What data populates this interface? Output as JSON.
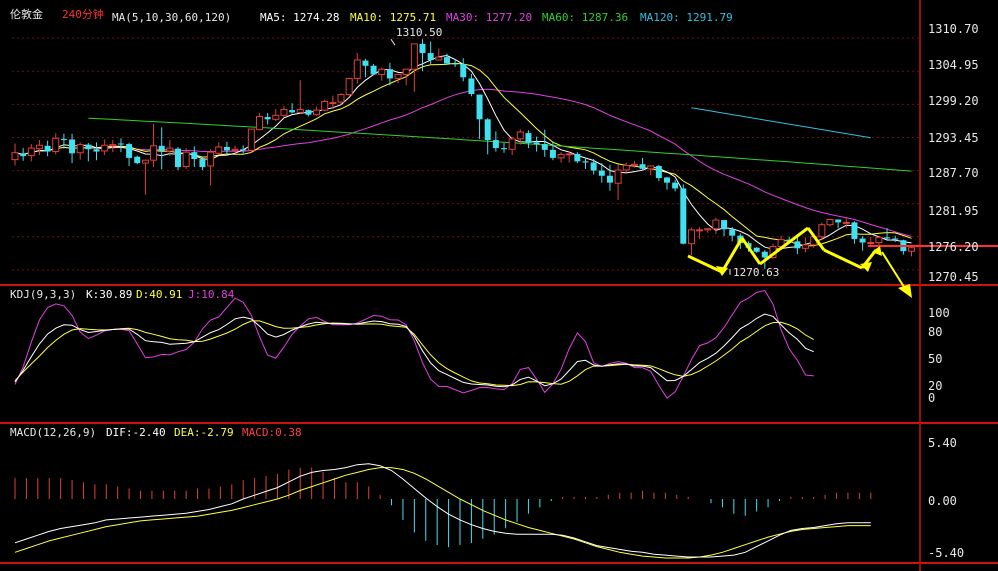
{
  "header": {
    "symbol": "伦敦金",
    "period": "240分钟",
    "ma_spec": "MA(5,10,30,60,120)",
    "ma5": "MA5: 1274.28",
    "ma10": "MA10: 1275.71",
    "ma30": "MA30: 1277.20",
    "ma60": "MA60: 1287.36",
    "ma120": "MA120: 1291.79"
  },
  "colors": {
    "background": "#000000",
    "up": "#e0403a",
    "down": "#40e0f0",
    "ma5": "#ffffff",
    "ma10": "#ffff40",
    "ma30": "#e040e0",
    "ma60": "#30d030",
    "ma120": "#30c0e0",
    "separator": "#d01010",
    "arrow": "#ffff00",
    "hline": "#ff3030",
    "grid": "#6a1010"
  },
  "price_panel": {
    "ticks": [
      "1310.70",
      "1304.95",
      "1299.20",
      "1293.45",
      "1287.70",
      "1281.95",
      "1276.20",
      "1270.45"
    ],
    "high_label": "1310.50",
    "low_label": "1270.63"
  },
  "kdj_panel": {
    "header": "KDJ(9,3,3)",
    "k": "K:30.89",
    "d": "D:40.91",
    "j": "J:10.84",
    "ticks": [
      "100",
      "80",
      "50",
      "20",
      "0"
    ]
  },
  "macd_panel": {
    "header": "MACD(12,26,9)",
    "dif": "DIF:-2.40",
    "dea": "DEA:-2.79",
    "macd": "MACD:0.38",
    "ticks": [
      "5.40",
      "0.00",
      "-5.40"
    ]
  },
  "chart_data": {
    "type": "candlestick",
    "title": "伦敦金 240分钟",
    "price_range": [
      1268.0,
      1313.5
    ],
    "candles": [
      [
        1289.6,
        1290.8,
        1288.6,
        1292.4
      ],
      [
        1290.7,
        1290.2,
        1289.4,
        1291.6
      ],
      [
        1290.3,
        1291.6,
        1289.3,
        1292.3
      ],
      [
        1291.5,
        1292.1,
        1290.4,
        1293.0
      ],
      [
        1292.0,
        1291.0,
        1290.2,
        1292.9
      ],
      [
        1291.0,
        1293.3,
        1290.5,
        1294.2
      ],
      [
        1293.2,
        1293.0,
        1291.5,
        1294.1
      ],
      [
        1293.1,
        1290.7,
        1289.0,
        1294.1
      ],
      [
        1290.8,
        1292.2,
        1289.6,
        1292.6
      ],
      [
        1292.2,
        1291.4,
        1289.3,
        1292.5
      ],
      [
        1291.4,
        1291.0,
        1289.5,
        1292.6
      ],
      [
        1291.1,
        1292.1,
        1290.4,
        1293.1
      ],
      [
        1292.0,
        1292.2,
        1290.9,
        1293.0
      ],
      [
        1292.4,
        1292.3,
        1290.9,
        1293.3
      ],
      [
        1292.3,
        1289.9,
        1288.5,
        1292.5
      ],
      [
        1290.1,
        1289.0,
        1288.8,
        1290.3
      ],
      [
        1289.0,
        1289.5,
        1283.5,
        1289.6
      ],
      [
        1289.5,
        1292.0,
        1288.3,
        1295.8
      ],
      [
        1292.0,
        1291.1,
        1287.9,
        1295.2
      ],
      [
        1291.1,
        1291.6,
        1290.2,
        1293.0
      ],
      [
        1291.5,
        1288.3,
        1287.8,
        1291.8
      ],
      [
        1288.4,
        1290.9,
        1288.0,
        1291.6
      ],
      [
        1290.9,
        1289.7,
        1288.3,
        1291.9
      ],
      [
        1289.7,
        1288.3,
        1287.8,
        1290.0
      ],
      [
        1288.5,
        1290.9,
        1285.1,
        1291.4
      ],
      [
        1290.7,
        1291.8,
        1290.4,
        1292.6
      ],
      [
        1291.8,
        1291.2,
        1290.4,
        1292.7
      ],
      [
        1291.2,
        1291.4,
        1290.7,
        1292.0
      ],
      [
        1291.4,
        1291.2,
        1290.6,
        1292.1
      ],
      [
        1291.2,
        1294.9,
        1290.8,
        1294.9
      ],
      [
        1294.8,
        1297.1,
        1294.7,
        1297.7
      ],
      [
        1297.0,
        1296.6,
        1295.7,
        1297.7
      ],
      [
        1296.6,
        1297.3,
        1296.3,
        1298.4
      ],
      [
        1297.3,
        1298.3,
        1297.0,
        1298.9
      ],
      [
        1298.2,
        1297.8,
        1297.6,
        1299.4
      ],
      [
        1297.8,
        1298.3,
        1297.6,
        1303.4
      ],
      [
        1298.2,
        1297.4,
        1297.1,
        1298.3
      ],
      [
        1297.4,
        1298.2,
        1297.2,
        1298.8
      ],
      [
        1298.2,
        1299.7,
        1298.0,
        1300.0
      ],
      [
        1299.5,
        1299.5,
        1298.4,
        1300.7
      ],
      [
        1299.6,
        1300.9,
        1299.2,
        1301.1
      ],
      [
        1300.9,
        1303.7,
        1300.7,
        1303.8
      ],
      [
        1303.7,
        1306.9,
        1302.8,
        1308.1
      ],
      [
        1306.8,
        1305.9,
        1303.9,
        1307.1
      ],
      [
        1305.9,
        1304.4,
        1304.3,
        1306.2
      ],
      [
        1304.4,
        1305.3,
        1303.3,
        1305.6
      ],
      [
        1305.3,
        1303.7,
        1302.5,
        1306.4
      ],
      [
        1303.7,
        1304.4,
        1302.9,
        1304.5
      ],
      [
        1304.4,
        1305.3,
        1302.5,
        1305.4
      ],
      [
        1305.3,
        1309.7,
        1301.4,
        1309.7
      ],
      [
        1309.7,
        1308.1,
        1305.0,
        1310.5
      ],
      [
        1308.1,
        1306.9,
        1306.2,
        1310.1
      ],
      [
        1306.9,
        1307.4,
        1306.8,
        1308.9
      ],
      [
        1307.4,
        1306.3,
        1306.1,
        1308.0
      ],
      [
        1306.3,
        1306.2,
        1305.7,
        1307.0
      ],
      [
        1306.2,
        1303.9,
        1303.2,
        1307.2
      ],
      [
        1303.7,
        1301.0,
        1300.6,
        1304.5
      ],
      [
        1300.9,
        1296.6,
        1293.2,
        1300.9
      ],
      [
        1296.6,
        1293.0,
        1290.5,
        1296.8
      ],
      [
        1293.0,
        1291.6,
        1291.0,
        1294.5
      ],
      [
        1291.6,
        1291.4,
        1290.8,
        1292.5
      ],
      [
        1291.4,
        1293.2,
        1290.4,
        1293.5
      ],
      [
        1293.2,
        1294.4,
        1292.2,
        1294.9
      ],
      [
        1294.2,
        1292.5,
        1291.6,
        1294.7
      ],
      [
        1292.6,
        1292.3,
        1291.0,
        1293.6
      ],
      [
        1292.3,
        1291.3,
        1290.1,
        1294.8
      ],
      [
        1291.3,
        1289.9,
        1289.5,
        1292.7
      ],
      [
        1289.9,
        1290.5,
        1289.1,
        1290.9
      ],
      [
        1290.5,
        1290.6,
        1289.1,
        1291.0
      ],
      [
        1290.6,
        1289.3,
        1289.0,
        1290.9
      ],
      [
        1289.3,
        1289.1,
        1288.0,
        1290.0
      ],
      [
        1289.1,
        1287.7,
        1287.0,
        1289.7
      ],
      [
        1287.7,
        1286.8,
        1285.6,
        1289.0
      ],
      [
        1286.8,
        1285.6,
        1284.2,
        1288.7
      ],
      [
        1285.5,
        1287.8,
        1282.6,
        1288.8
      ],
      [
        1287.8,
        1288.6,
        1287.4,
        1289.1
      ],
      [
        1288.6,
        1288.8,
        1288.2,
        1289.4
      ],
      [
        1288.8,
        1288.0,
        1287.7,
        1289.9
      ],
      [
        1288.0,
        1288.5,
        1286.9,
        1288.6
      ],
      [
        1288.5,
        1286.4,
        1285.9,
        1288.7
      ],
      [
        1286.5,
        1285.6,
        1284.4,
        1286.6
      ],
      [
        1285.6,
        1284.6,
        1284.1,
        1286.1
      ],
      [
        1284.6,
        1275.0,
        1274.9,
        1285.3
      ],
      [
        1275.0,
        1277.4,
        1273.0,
        1277.8
      ],
      [
        1277.4,
        1277.4,
        1275.8,
        1277.9
      ],
      [
        1277.4,
        1277.6,
        1276.9,
        1277.7
      ],
      [
        1277.6,
        1279.1,
        1276.7,
        1279.5
      ],
      [
        1279.1,
        1277.5,
        1276.3,
        1279.1
      ],
      [
        1277.5,
        1276.4,
        1275.4,
        1277.9
      ],
      [
        1276.4,
        1275.1,
        1274.1,
        1276.8
      ],
      [
        1275.1,
        1274.3,
        1273.6,
        1275.4
      ],
      [
        1274.3,
        1273.6,
        1273.4,
        1274.4
      ],
      [
        1273.6,
        1272.6,
        1270.6,
        1273.9
      ],
      [
        1272.6,
        1274.5,
        1272.4,
        1275.0
      ],
      [
        1274.5,
        1275.7,
        1274.0,
        1276.4
      ],
      [
        1275.7,
        1275.4,
        1275.2,
        1276.2
      ],
      [
        1275.4,
        1274.2,
        1273.2,
        1276.1
      ],
      [
        1274.2,
        1274.8,
        1273.5,
        1276.1
      ],
      [
        1274.8,
        1276.2,
        1274.3,
        1276.8
      ],
      [
        1276.2,
        1278.3,
        1275.6,
        1278.7
      ],
      [
        1278.3,
        1279.2,
        1278.0,
        1279.3
      ],
      [
        1279.2,
        1278.7,
        1277.7,
        1279.2
      ],
      [
        1278.7,
        1278.7,
        1277.7,
        1279.6
      ],
      [
        1278.7,
        1275.8,
        1275.0,
        1278.9
      ],
      [
        1275.9,
        1275.2,
        1273.8,
        1276.3
      ],
      [
        1275.2,
        1275.2,
        1274.4,
        1276.2
      ],
      [
        1275.2,
        1276.1,
        1274.2,
        1276.4
      ],
      [
        1276.1,
        1275.9,
        1275.5,
        1277.7
      ],
      [
        1275.9,
        1275.7,
        1275.3,
        1276.4
      ],
      [
        1275.6,
        1273.7,
        1273.1,
        1275.7
      ],
      [
        1273.7,
        1274.3,
        1272.8,
        1274.5
      ]
    ],
    "ma60": [
      1296.8,
      1287.6
    ],
    "ma120": [
      1298.6,
      1293.4
    ],
    "kdj": {
      "range": [
        0,
        100
      ],
      "k": [
        22.0,
        31.9,
        43.5,
        54.3,
        62.6,
        67.6,
        70.5,
        70.2,
        66.4,
        64.0,
        64.8,
        65.8,
        66.5,
        67.0,
        66.9,
        62.4,
        57.0,
        56.1,
        55.6,
        54.1,
        54.5,
        54.9,
        56.1,
        60.1,
        63.9,
        66.4,
        70.8,
        75.6,
        77.0,
        75.4,
        69.4,
        62.6,
        60.1,
        62.3,
        66.0,
        68.7,
        71.2,
        72.6,
        72.0,
        71.5,
        71.4,
        71.1,
        71.3,
        72.5,
        73.7,
        73.2,
        71.4,
        70.9,
        69.1,
        60.5,
        48.5,
        38.1,
        31.6,
        28.3,
        25.0,
        21.7,
        20.3,
        19.9,
        19.5,
        18.4,
        18.0,
        19.6,
        24.2,
        26.2,
        22.9,
        18.8,
        20.6,
        24.5,
        31.8,
        39.4,
        40.4,
        36.4,
        35.4,
        36.6,
        37.4,
        37.3,
        35.7,
        35.5,
        34.2,
        28.6,
        23.1,
        23.3,
        26.8,
        32.6,
        38.5,
        42.1,
        46.4,
        52.6,
        59.7,
        67.2,
        71.1,
        75.9,
        79.7,
        77.6,
        70.4,
        63.6,
        58.1,
        50.6,
        47.7
      ],
      "d": [
        23.1,
        30.5,
        37.4,
        44.1,
        51.3,
        57.3,
        62.5,
        66.1,
        67.3,
        66.7,
        66.3,
        66.1,
        66.5,
        67.1,
        67.6,
        66.4,
        64.1,
        62.5,
        60.7,
        58.7,
        57.9,
        57.5,
        56.3,
        56.6,
        58.5,
        61.0,
        63.6,
        66.8,
        70.8,
        73.8,
        73.8,
        71.5,
        69.0,
        67.6,
        67.7,
        68.3,
        69.0,
        70.4,
        71.4,
        72.0,
        71.8,
        71.4,
        70.9,
        71.2,
        71.3,
        70.9,
        69.7,
        69.1,
        68.4,
        62.3,
        53.5,
        45.0,
        38.2,
        33.3,
        29.7,
        26.2,
        23.0,
        21.2,
        20.5,
        19.5,
        19.2,
        19.0,
        19.9,
        22.2,
        22.1,
        21.5,
        20.7,
        20.2,
        22.6,
        27.3,
        32.5,
        35.5,
        35.5,
        35.9,
        36.5,
        37.0,
        36.5,
        36.2,
        35.7,
        33.3,
        30.5,
        28.1,
        26.8,
        28.4,
        31.4,
        35.6,
        39.8,
        44.8,
        50.0,
        56.0,
        60.1,
        64.9,
        69.7,
        72.4,
        72.6,
        70.4,
        67.0,
        61.9,
        58.0
      ],
      "j": [
        19.9,
        34.6,
        55.8,
        74.7,
        85.2,
        88.2,
        86.6,
        78.5,
        64.4,
        58.8,
        61.8,
        65.3,
        66.6,
        66.8,
        65.5,
        54.2,
        42.6,
        43.3,
        45.4,
        45.0,
        47.6,
        49.6,
        55.8,
        67.0,
        74.6,
        77.2,
        85.2,
        93.1,
        89.6,
        78.6,
        60.5,
        44.8,
        42.3,
        51.6,
        62.5,
        69.5,
        75.5,
        76.8,
        73.3,
        70.5,
        70.5,
        70.6,
        72.0,
        75.2,
        78.4,
        77.8,
        74.8,
        74.6,
        70.5,
        56.9,
        38.4,
        24.3,
        18.3,
        18.2,
        15.6,
        12.9,
        14.9,
        17.3,
        17.4,
        16.2,
        15.6,
        20.7,
        32.7,
        34.2,
        24.4,
        13.2,
        20.4,
        32.9,
        50.3,
        63.6,
        56.2,
        38.4,
        35.2,
        37.9,
        39.3,
        38.0,
        34.2,
        34.1,
        31.1,
        19.1,
        8.4,
        13.7,
        26.9,
        41.1,
        52.9,
        55.2,
        59.6,
        68.2,
        79.0,
        89.6,
        93.1,
        98.0,
        99.6,
        88.0,
        66.1,
        50.0,
        40.4,
        28.0,
        27.2
      ],
      "labels": {
        "k": "K:30.89",
        "d": "D:40.91",
        "j": "J:10.84"
      }
    },
    "macd": {
      "range": [
        -6.2,
        6.2
      ],
      "dif": [
        -4.6,
        -4.2,
        -3.8,
        -3.4,
        -3.1,
        -2.9,
        -2.7,
        -2.5,
        -2.2,
        -2.1,
        -2.0,
        -1.9,
        -1.8,
        -1.7,
        -1.6,
        -1.5,
        -1.3,
        -1.1,
        -0.8,
        -0.5,
        0.0,
        0.4,
        0.8,
        1.2,
        1.8,
        2.4,
        2.8,
        3.0,
        3.1,
        3.3,
        3.6,
        3.7,
        3.5,
        3.0,
        2.1,
        1.1,
        0.1,
        -0.8,
        -1.6,
        -2.2,
        -2.7,
        -3.1,
        -3.4,
        -3.6,
        -3.7,
        -3.7,
        -3.7,
        -3.7,
        -3.8,
        -4.1,
        -4.5,
        -4.9,
        -5.1,
        -5.3,
        -5.5,
        -5.6,
        -5.8,
        -5.9,
        -6.0,
        -6.1,
        -6.1,
        -6.1,
        -6.0,
        -5.9,
        -5.6,
        -5.0,
        -4.4,
        -3.8,
        -3.3,
        -3.1,
        -3.0,
        -2.8,
        -2.6,
        -2.5,
        -2.5,
        -2.5
      ],
      "dea": [
        -5.6,
        -5.2,
        -4.8,
        -4.4,
        -4.1,
        -3.8,
        -3.5,
        -3.2,
        -2.9,
        -2.7,
        -2.5,
        -2.3,
        -2.2,
        -2.1,
        -2.0,
        -1.9,
        -1.8,
        -1.6,
        -1.4,
        -1.2,
        -0.9,
        -0.6,
        -0.3,
        0.0,
        0.4,
        0.9,
        1.3,
        1.7,
        2.1,
        2.5,
        2.8,
        3.1,
        3.3,
        3.3,
        3.1,
        2.7,
        2.1,
        1.4,
        0.7,
        0.0,
        -0.6,
        -1.2,
        -1.7,
        -2.2,
        -2.6,
        -3.0,
        -3.3,
        -3.6,
        -3.9,
        -4.2,
        -4.6,
        -5.0,
        -5.3,
        -5.6,
        -5.8,
        -6.0,
        -6.1,
        -6.2,
        -6.2,
        -6.2,
        -6.1,
        -5.9,
        -5.6,
        -5.2,
        -4.8,
        -4.4,
        -4.0,
        -3.7,
        -3.4,
        -3.2,
        -3.1,
        -3.0,
        -2.9,
        -2.8,
        -2.8,
        -2.8
      ],
      "labels": {
        "dif": "DIF:-2.40",
        "dea": "DEA:-2.79",
        "macd": "MACD:0.38"
      }
    }
  }
}
